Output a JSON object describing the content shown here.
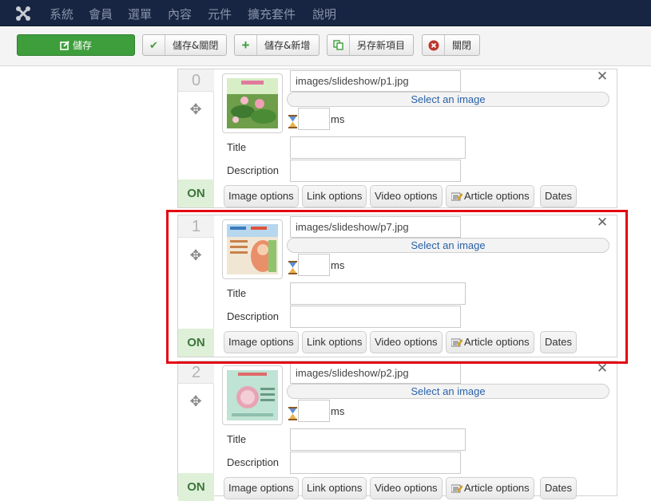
{
  "topnav": {
    "logo": "joomla-logo-icon",
    "items": [
      "系統",
      "會員",
      "選單",
      "內容",
      "元件",
      "擴充套件",
      "說明"
    ]
  },
  "toolbar": {
    "save": "儲存",
    "save_close": "儲存&關閉",
    "save_new": "儲存&新增",
    "save_copy": "另存新項目",
    "close": "關閉"
  },
  "items": [
    {
      "number": "0",
      "path": "images/slideshow/p1.jpg",
      "select": "Select an image",
      "ms": "ms",
      "title_label": "Title",
      "description_label": "Description",
      "status": "ON",
      "options": [
        "Image options",
        "Link options",
        "Video options",
        "Article options",
        "Dates"
      ],
      "thumb_icon": "lotus-photo-thumbnail"
    },
    {
      "number": "1",
      "path": "images/slideshow/p7.jpg",
      "select": "Select an image",
      "ms": "ms",
      "title_label": "Title",
      "description_label": "Description",
      "status": "ON",
      "options": [
        "Image options",
        "Link options",
        "Video options",
        "Article options",
        "Dates"
      ],
      "thumb_icon": "poster-thumbnail"
    },
    {
      "number": "2",
      "path": "images/slideshow/p2.jpg",
      "select": "Select an image",
      "ms": "ms",
      "title_label": "Title",
      "description_label": "Description",
      "status": "ON",
      "options": [
        "Image options",
        "Link options",
        "Video options",
        "Article options",
        "Dates"
      ],
      "thumb_icon": "flyer-thumbnail"
    }
  ],
  "colors": {
    "nav_bg": "#172543",
    "save_green": "#3f9e3c",
    "on_green": "#3c763d",
    "link_blue": "#2a62a8",
    "highlight_red": "#e30613"
  }
}
